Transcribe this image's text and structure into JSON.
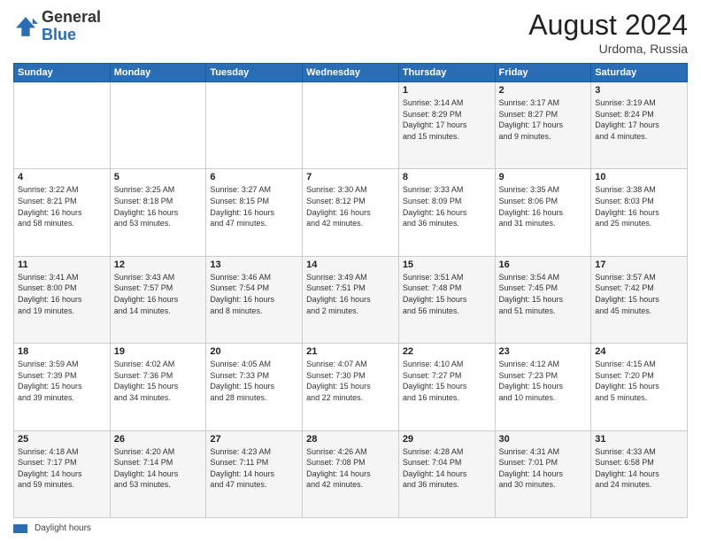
{
  "header": {
    "logo_general": "General",
    "logo_blue": "Blue",
    "month_title": "August 2024",
    "subtitle": "Urdoma, Russia"
  },
  "calendar": {
    "days_of_week": [
      "Sunday",
      "Monday",
      "Tuesday",
      "Wednesday",
      "Thursday",
      "Friday",
      "Saturday"
    ],
    "weeks": [
      [
        {
          "day": "",
          "info": ""
        },
        {
          "day": "",
          "info": ""
        },
        {
          "day": "",
          "info": ""
        },
        {
          "day": "",
          "info": ""
        },
        {
          "day": "1",
          "info": "Sunrise: 3:14 AM\nSunset: 8:29 PM\nDaylight: 17 hours\nand 15 minutes."
        },
        {
          "day": "2",
          "info": "Sunrise: 3:17 AM\nSunset: 8:27 PM\nDaylight: 17 hours\nand 9 minutes."
        },
        {
          "day": "3",
          "info": "Sunrise: 3:19 AM\nSunset: 8:24 PM\nDaylight: 17 hours\nand 4 minutes."
        }
      ],
      [
        {
          "day": "4",
          "info": "Sunrise: 3:22 AM\nSunset: 8:21 PM\nDaylight: 16 hours\nand 58 minutes."
        },
        {
          "day": "5",
          "info": "Sunrise: 3:25 AM\nSunset: 8:18 PM\nDaylight: 16 hours\nand 53 minutes."
        },
        {
          "day": "6",
          "info": "Sunrise: 3:27 AM\nSunset: 8:15 PM\nDaylight: 16 hours\nand 47 minutes."
        },
        {
          "day": "7",
          "info": "Sunrise: 3:30 AM\nSunset: 8:12 PM\nDaylight: 16 hours\nand 42 minutes."
        },
        {
          "day": "8",
          "info": "Sunrise: 3:33 AM\nSunset: 8:09 PM\nDaylight: 16 hours\nand 36 minutes."
        },
        {
          "day": "9",
          "info": "Sunrise: 3:35 AM\nSunset: 8:06 PM\nDaylight: 16 hours\nand 31 minutes."
        },
        {
          "day": "10",
          "info": "Sunrise: 3:38 AM\nSunset: 8:03 PM\nDaylight: 16 hours\nand 25 minutes."
        }
      ],
      [
        {
          "day": "11",
          "info": "Sunrise: 3:41 AM\nSunset: 8:00 PM\nDaylight: 16 hours\nand 19 minutes."
        },
        {
          "day": "12",
          "info": "Sunrise: 3:43 AM\nSunset: 7:57 PM\nDaylight: 16 hours\nand 14 minutes."
        },
        {
          "day": "13",
          "info": "Sunrise: 3:46 AM\nSunset: 7:54 PM\nDaylight: 16 hours\nand 8 minutes."
        },
        {
          "day": "14",
          "info": "Sunrise: 3:49 AM\nSunset: 7:51 PM\nDaylight: 16 hours\nand 2 minutes."
        },
        {
          "day": "15",
          "info": "Sunrise: 3:51 AM\nSunset: 7:48 PM\nDaylight: 15 hours\nand 56 minutes."
        },
        {
          "day": "16",
          "info": "Sunrise: 3:54 AM\nSunset: 7:45 PM\nDaylight: 15 hours\nand 51 minutes."
        },
        {
          "day": "17",
          "info": "Sunrise: 3:57 AM\nSunset: 7:42 PM\nDaylight: 15 hours\nand 45 minutes."
        }
      ],
      [
        {
          "day": "18",
          "info": "Sunrise: 3:59 AM\nSunset: 7:39 PM\nDaylight: 15 hours\nand 39 minutes."
        },
        {
          "day": "19",
          "info": "Sunrise: 4:02 AM\nSunset: 7:36 PM\nDaylight: 15 hours\nand 34 minutes."
        },
        {
          "day": "20",
          "info": "Sunrise: 4:05 AM\nSunset: 7:33 PM\nDaylight: 15 hours\nand 28 minutes."
        },
        {
          "day": "21",
          "info": "Sunrise: 4:07 AM\nSunset: 7:30 PM\nDaylight: 15 hours\nand 22 minutes."
        },
        {
          "day": "22",
          "info": "Sunrise: 4:10 AM\nSunset: 7:27 PM\nDaylight: 15 hours\nand 16 minutes."
        },
        {
          "day": "23",
          "info": "Sunrise: 4:12 AM\nSunset: 7:23 PM\nDaylight: 15 hours\nand 10 minutes."
        },
        {
          "day": "24",
          "info": "Sunrise: 4:15 AM\nSunset: 7:20 PM\nDaylight: 15 hours\nand 5 minutes."
        }
      ],
      [
        {
          "day": "25",
          "info": "Sunrise: 4:18 AM\nSunset: 7:17 PM\nDaylight: 14 hours\nand 59 minutes."
        },
        {
          "day": "26",
          "info": "Sunrise: 4:20 AM\nSunset: 7:14 PM\nDaylight: 14 hours\nand 53 minutes."
        },
        {
          "day": "27",
          "info": "Sunrise: 4:23 AM\nSunset: 7:11 PM\nDaylight: 14 hours\nand 47 minutes."
        },
        {
          "day": "28",
          "info": "Sunrise: 4:26 AM\nSunset: 7:08 PM\nDaylight: 14 hours\nand 42 minutes."
        },
        {
          "day": "29",
          "info": "Sunrise: 4:28 AM\nSunset: 7:04 PM\nDaylight: 14 hours\nand 36 minutes."
        },
        {
          "day": "30",
          "info": "Sunrise: 4:31 AM\nSunset: 7:01 PM\nDaylight: 14 hours\nand 30 minutes."
        },
        {
          "day": "31",
          "info": "Sunrise: 4:33 AM\nSunset: 6:58 PM\nDaylight: 14 hours\nand 24 minutes."
        }
      ]
    ]
  },
  "footer": {
    "swatch_label": "Daylight hours"
  }
}
